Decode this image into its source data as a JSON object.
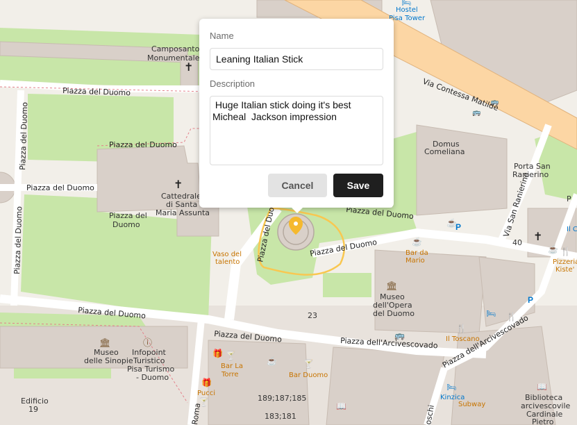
{
  "popup": {
    "name_label": "Name",
    "name_value": "Leaning Italian Stick",
    "description_label": "Description",
    "description_value": " Huge Italian stick doing it's best\nMicheal  Jackson impression",
    "cancel_label": "Cancel",
    "save_label": "Save"
  },
  "map": {
    "labels": {
      "hostel": "Hostel",
      "pisa_tower": "Pisa Tower",
      "camposanto_1": "Camposanto",
      "camposanto_2": "Monumentale",
      "piazza_duomo": "Piazza del Duomo",
      "via_contessa": "Via Contessa Matilde",
      "domus_1": "Domus",
      "domus_2": "Comeliana",
      "porta_1": "Porta San",
      "porta_2": "Ranierino",
      "via_san_ranierino": "Via San Ranierino",
      "cattedrale_1": "Cattedrale",
      "cattedrale_2": "di Santa",
      "cattedrale_3": "Maria Assunta",
      "piazza_del": "Piazza del",
      "duomo": "Duomo",
      "vaso_1": "Vaso del",
      "vaso_2": "talento",
      "bar_da_1": "Bar da",
      "bar_da_2": "Mario",
      "museo_opera_1": "Museo",
      "museo_opera_2": "dell'Opera",
      "museo_opera_3": "del Duomo",
      "num_23": "23",
      "il_toscano": "Il Toscano",
      "piazza_arcivescovado": "Piazza dell'Arcivescovado",
      "museo_sinopie_1": "Museo",
      "museo_sinopie_2": "delle Sinopie",
      "infopoint_1": "Infopoint",
      "infopoint_2": "Turistico",
      "infopoint_3": "Pisa Turismo",
      "infopoint_4": "- Duomo",
      "bar_la_1": "Bar La",
      "bar_la_2": "Torre",
      "bar_duomo": "Bar Duomo",
      "pucci": "Pucci",
      "edificio_1": "Edificio",
      "edificio_2": "19",
      "num_189": "189;187;185",
      "num_183": "183;181",
      "kinzica": "Kinzica",
      "subway": "Subway",
      "biblioteca_1": "Biblioteca",
      "biblioteca_2": "arcivescovile",
      "biblioteca_3": "Cardinale",
      "biblioteca_4": "Pietro",
      "num_40": "40",
      "pizzeria_1": "Pizzeria",
      "pizzeria_2": "Kiste'",
      "il_c": "Il C",
      "p_frag": "P",
      "roma": "Roma",
      "oschi": "oschi"
    },
    "colors": {
      "base": "#f2efe9",
      "grass": "#c8e6a8",
      "building": "#d9d0c9",
      "road": "#ffffff",
      "main_road": "#fcd6a4",
      "path": "#cfc8e2",
      "route": "#f9c750",
      "marker": "#f5b92e",
      "poi": "#c77400",
      "transit": "#0077cc"
    },
    "icons": [
      "cross-icon",
      "museum-icon",
      "info-icon",
      "bar-icon",
      "cafe-icon",
      "restaurant-icon",
      "parking-icon",
      "bus-icon",
      "gift-icon",
      "book-icon",
      "hotel-icon",
      "location-marker-icon"
    ]
  }
}
